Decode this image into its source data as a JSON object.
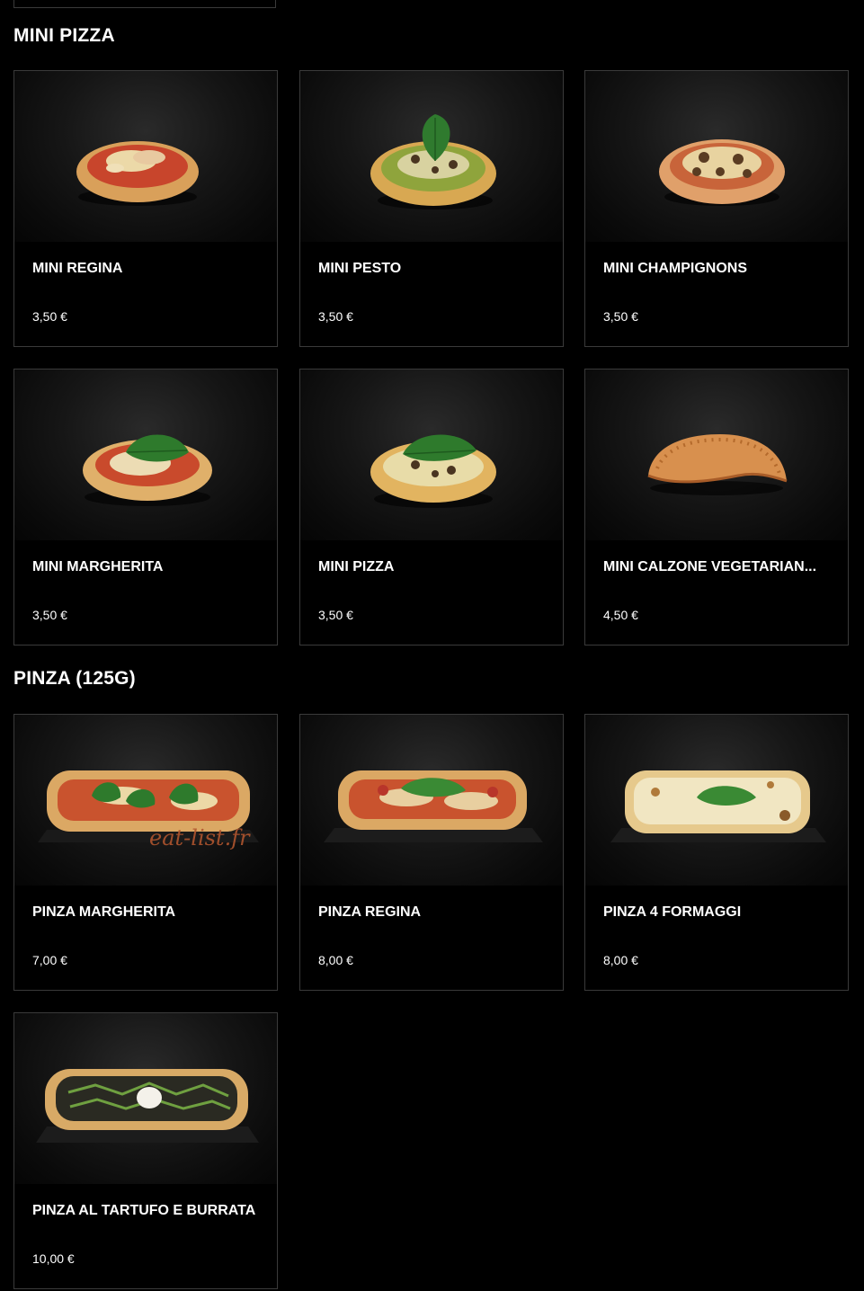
{
  "sections": [
    {
      "title": "MINI PIZZA",
      "items": [
        {
          "name": "MINI REGINA",
          "price": "3,50 €",
          "image": "mini-regina-photo"
        },
        {
          "name": "MINI PESTO",
          "price": "3,50 €",
          "image": "mini-pesto-photo"
        },
        {
          "name": "MINI CHAMPIGNONS",
          "price": "3,50 €",
          "image": "mini-champignons-photo"
        },
        {
          "name": "MINI MARGHERITA",
          "price": "3,50 €",
          "image": "mini-margherita-photo"
        },
        {
          "name": "MINI PIZZA",
          "price": "3,50 €",
          "image": "mini-pizza-photo"
        },
        {
          "name": "MINI CALZONE VEGETARIAN...",
          "price": "4,50 €",
          "image": "mini-calzone-photo"
        }
      ]
    },
    {
      "title": "PINZA (125G)",
      "items": [
        {
          "name": "PINZA MARGHERITA",
          "price": "7,00 €",
          "image": "pinza-margherita-photo"
        },
        {
          "name": "PINZA REGINA",
          "price": "8,00 €",
          "image": "pinza-regina-photo"
        },
        {
          "name": "PINZA 4 FORMAGGI",
          "price": "8,00 €",
          "image": "pinza-4-formaggi-photo"
        },
        {
          "name": "PINZA AL TARTUFO E BURRATA",
          "price": "10,00 €",
          "image": "pinza-tartufo-burrata-photo"
        }
      ]
    }
  ],
  "watermark": "eat-list.fr"
}
